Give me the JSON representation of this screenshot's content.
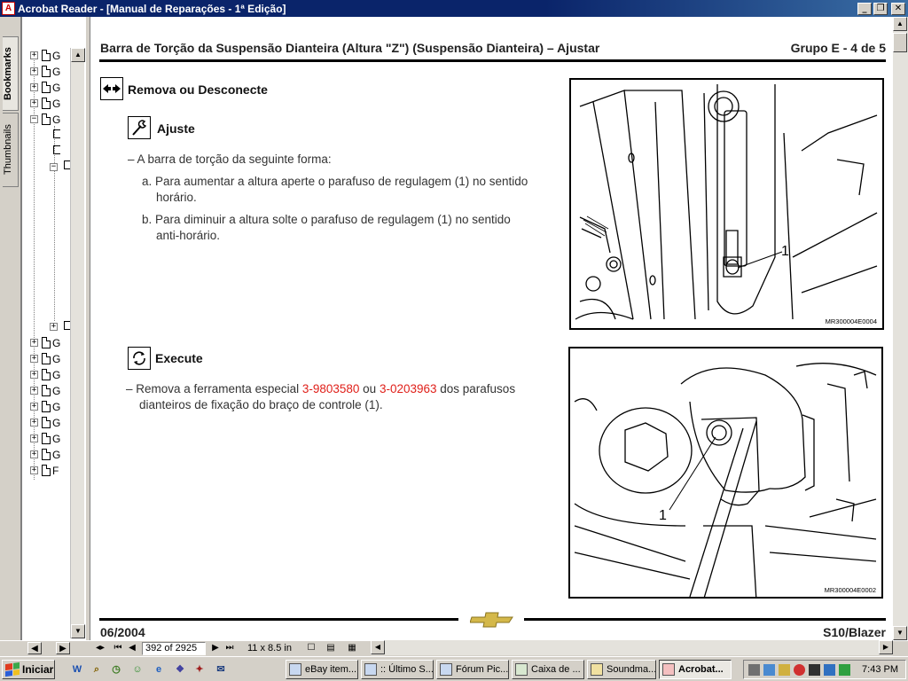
{
  "window": {
    "app_icon": "acrobat-icon",
    "title": "Acrobat Reader - [Manual de Reparações - 1ª Edição]",
    "controls": [
      "minimize",
      "restore",
      "close"
    ]
  },
  "nav_tabs": [
    {
      "label": "Bookmarks",
      "active": true
    },
    {
      "label": "Thumbnails",
      "active": false
    }
  ],
  "bookmarks": [
    {
      "label": "G",
      "expander": "+"
    },
    {
      "label": "G",
      "expander": "+"
    },
    {
      "label": "G",
      "expander": "+"
    },
    {
      "label": "G",
      "expander": "+"
    },
    {
      "label": "G",
      "expander": "−"
    },
    {
      "label": "G",
      "expander": "+"
    },
    {
      "label": "G",
      "expander": "+"
    },
    {
      "label": "G",
      "expander": "+"
    },
    {
      "label": "G",
      "expander": "+"
    },
    {
      "label": "G",
      "expander": "+"
    },
    {
      "label": "G",
      "expander": "+"
    },
    {
      "label": "G",
      "expander": "+"
    },
    {
      "label": "G",
      "expander": "+"
    },
    {
      "label": "F",
      "expander": "+"
    }
  ],
  "page": {
    "header_title": "Barra de Torção da Suspensão Dianteira (Altura \"Z\") (Suspensão Dianteira) – Ajustar",
    "header_group": "Grupo E - 4 de 5",
    "remove_heading": "Remova ou Desconecte",
    "adjust_heading": "Ajuste",
    "adjust_intro": "–  A barra de torção da seguinte forma:",
    "adjust_a_line1": "a. Para aumentar a altura aperte o parafuso de regulagem (1) no sentido",
    "adjust_a_line2": "horário.",
    "adjust_b_line1": "b. Para diminuir a altura solte o parafuso de regulagem (1) no sentido",
    "adjust_b_line2": "anti-horário.",
    "execute_heading": "Execute",
    "execute_prefix": "–  Remova a ferramenta especial ",
    "tool1": "3-9803580",
    "execute_mid": " ou ",
    "tool2": "3-0203963",
    "execute_suffix": " dos parafusos",
    "execute_line2": "dianteiros de fixação do braço de controle (1).",
    "figure1": {
      "callout": "1",
      "id": "MR300004E0004"
    },
    "figure2": {
      "callout": "1",
      "id": "MR300004E0002"
    },
    "footer_date": "06/2004",
    "footer_model": "S10/Blazer",
    "brand_logo": "chevrolet-bowtie-logo"
  },
  "status": {
    "page_field": "392 of 2925",
    "page_size": "11 x 8.5 in"
  },
  "taskbar": {
    "start_label": "Iniciar",
    "quick_launch": [
      "word-icon",
      "search-icon",
      "clock-icon",
      "chat-icon",
      "ie-icon",
      "app-icon",
      "app-icon",
      "outlook-icon"
    ],
    "tasks": [
      {
        "label": "eBay item...",
        "active": false
      },
      {
        "label": ":: Último S...",
        "active": false
      },
      {
        "label": "Fórum Pic...",
        "active": false
      },
      {
        "label": "Caixa de ...",
        "active": false
      },
      {
        "label": "Soundma...",
        "active": false
      },
      {
        "label": "Acrobat...",
        "active": true
      }
    ],
    "clock": "7:43 PM"
  },
  "colors": {
    "titlebar": "#0a246a",
    "link_red": "#e0201a",
    "chrome": "#d4d0c8"
  }
}
